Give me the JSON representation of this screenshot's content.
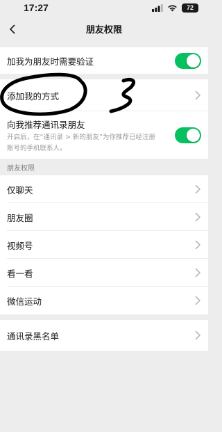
{
  "status_bar": {
    "time": "17:27",
    "battery": "72"
  },
  "nav": {
    "title": "朋友权限"
  },
  "verify_row": {
    "label": "加我为朋友时需要验证",
    "toggle_on": true
  },
  "add_method_row": {
    "label": "添加我的方式"
  },
  "recommend_row": {
    "label": "向我推荐通讯录朋友",
    "desc_line1": "开启后，在“通讯录 > 新的朋友”为你推荐已经注册",
    "desc_line2": "账号的手机联系人。",
    "toggle_on": true
  },
  "section_header": "朋友权限",
  "permission_items": [
    {
      "label": "仅聊天"
    },
    {
      "label": "朋友圈"
    },
    {
      "label": "视频号"
    },
    {
      "label": "看一看"
    },
    {
      "label": "微信运动"
    }
  ],
  "blacklist_row": {
    "label": "通讯录黑名单"
  },
  "colors": {
    "accent": "#07c160",
    "background": "#ededed",
    "annotation": "#000000"
  }
}
